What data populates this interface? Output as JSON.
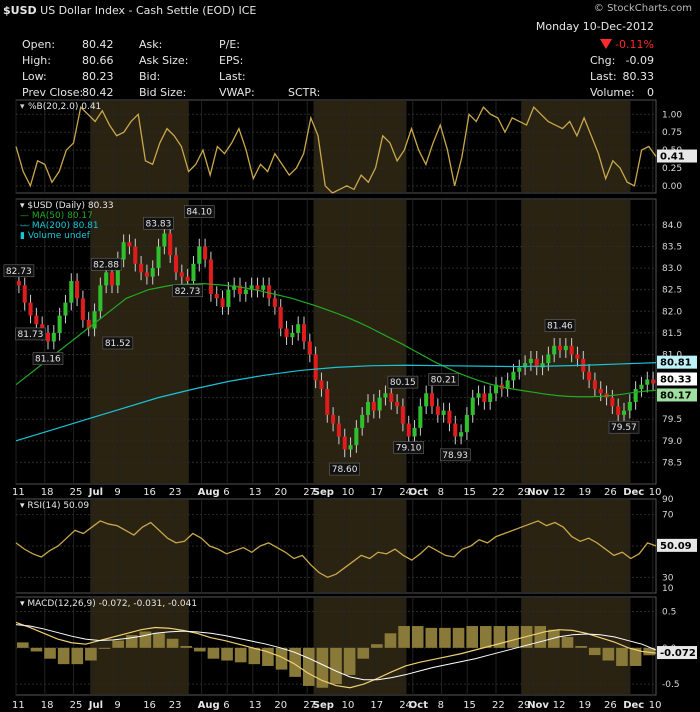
{
  "header": {
    "symbol": "$USD",
    "name": "US Dollar Index - Cash Settle (EOD)",
    "exchange": "ICE",
    "brand": "© StockCharts.com",
    "date": "Monday 10-Dec-2012",
    "change_pct": "-0.11%",
    "quote": [
      {
        "label": "Open:",
        "value": "80.42"
      },
      {
        "label": "High:",
        "value": "80.66"
      },
      {
        "label": "Low:",
        "value": "80.23"
      },
      {
        "label": "Prev Close:",
        "value": "80.42"
      }
    ],
    "col2": [
      "Ask:",
      "Ask Size:",
      "Bid:",
      "Bid Size:"
    ],
    "col3": [
      "P/E:",
      "EPS:",
      "Last:",
      "VWAP:"
    ],
    "sctr": "SCTR:",
    "right": [
      {
        "label": "Chg:",
        "value": "-0.09"
      },
      {
        "label": "Last:",
        "value": "80.33"
      },
      {
        "label": "Volume:",
        "value": "0"
      }
    ]
  },
  "colors": {
    "up": "#2fbf2f",
    "down": "#e01c1c",
    "ma50": "#22aa22",
    "ma200": "#19c4d6",
    "indicator": "#c9a84a",
    "shade": "#2a2312"
  },
  "chart_data": [
    {
      "type": "line",
      "title": "%B(20,2.0) 0.41",
      "series": [
        {
          "name": "%B(20,2.0)",
          "values": [
            0.55,
            0.2,
            0.0,
            0.35,
            0.3,
            0.05,
            0.2,
            0.5,
            0.6,
            1.1,
            1.0,
            0.9,
            1.05,
            0.85,
            0.7,
            0.75,
            0.9,
            1.0,
            0.35,
            0.3,
            0.6,
            0.8,
            0.7,
            0.55,
            0.2,
            0.3,
            0.5,
            0.15,
            0.55,
            0.45,
            0.6,
            0.8,
            0.5,
            0.1,
            0.3,
            0.2,
            0.45,
            0.3,
            0.15,
            0.25,
            0.45,
            0.95,
            0.7,
            0.0,
            -0.1,
            -0.05,
            0.0,
            -0.05,
            0.15,
            0.05,
            0.25,
            0.7,
            0.6,
            0.35,
            0.5,
            0.8,
            0.5,
            0.3,
            0.6,
            0.85,
            0.5,
            0.0,
            0.4,
            1.0,
            0.9,
            1.1,
            1.0,
            0.95,
            0.75,
            0.95,
            0.9,
            0.85,
            1.1,
            1.0,
            0.9,
            0.85,
            0.8,
            0.9,
            0.7,
            0.95,
            0.7,
            0.45,
            0.1,
            0.35,
            0.25,
            0.05,
            0.0,
            0.5,
            0.55,
            0.41
          ]
        }
      ],
      "ylim": [
        -0.1,
        1.2
      ],
      "yticks": [
        0.0,
        0.25,
        0.5,
        0.75,
        1.0
      ],
      "ytick_labels": [
        "0.00",
        "0.25",
        "0.50",
        "0.75",
        "1.00"
      ],
      "last_label": "0.41"
    },
    {
      "type": "candlestick",
      "title": "$USD (Daily) 80.33",
      "legend": [
        "MA(50) 80.17",
        "MA(200) 80.81",
        "Volume undef"
      ],
      "ylim": [
        78.0,
        84.6
      ],
      "yticks": [
        78.5,
        79.0,
        79.5,
        80.0,
        80.5,
        81.0,
        81.5,
        82.0,
        82.5,
        83.0,
        83.5,
        84.0
      ],
      "ytick_labels": [
        "78.5",
        "79.0",
        "79.5",
        "80.0",
        "80.5",
        "81.0",
        "81.5",
        "82.0",
        "82.5",
        "83.0",
        "83.5",
        "84.0"
      ],
      "closes": [
        82.6,
        82.2,
        81.9,
        81.7,
        81.5,
        81.3,
        81.5,
        81.9,
        82.2,
        82.7,
        82.3,
        81.8,
        81.6,
        82.0,
        82.6,
        82.9,
        82.6,
        83.2,
        83.6,
        83.5,
        83.1,
        82.9,
        82.8,
        83.0,
        83.5,
        83.8,
        83.3,
        82.9,
        82.8,
        82.7,
        83.1,
        83.5,
        83.2,
        82.4,
        82.3,
        82.1,
        82.5,
        82.6,
        82.4,
        82.5,
        82.6,
        82.5,
        82.6,
        82.3,
        82.1,
        81.6,
        81.4,
        81.5,
        81.7,
        81.3,
        81.0,
        80.4,
        80.2,
        79.6,
        79.4,
        79.1,
        78.8,
        78.9,
        79.3,
        79.6,
        79.9,
        79.7,
        80.0,
        80.1,
        79.9,
        79.8,
        79.4,
        79.1,
        79.3,
        79.8,
        80.1,
        79.8,
        79.6,
        79.7,
        79.4,
        79.1,
        79.2,
        79.6,
        80.0,
        80.1,
        79.9,
        80.1,
        80.3,
        80.2,
        80.4,
        80.6,
        80.7,
        80.8,
        80.9,
        80.7,
        80.8,
        81.0,
        81.2,
        81.1,
        81.2,
        81.0,
        80.9,
        80.6,
        80.4,
        80.2,
        80.1,
        80.0,
        79.8,
        79.6,
        79.7,
        79.9,
        80.2,
        80.3,
        80.42,
        80.33
      ],
      "ma50": [
        80.3,
        80.5,
        80.7,
        80.9,
        81.1,
        81.3,
        81.5,
        81.7,
        81.9,
        82.1,
        82.3,
        82.4,
        82.5,
        82.55,
        82.6,
        82.62,
        82.63,
        82.64,
        82.62,
        82.6,
        82.57,
        82.53,
        82.48,
        82.42,
        82.36,
        82.3,
        82.22,
        82.14,
        82.05,
        81.96,
        81.86,
        81.75,
        81.63,
        81.5,
        81.37,
        81.24,
        81.1,
        80.96,
        80.82,
        80.7,
        80.58,
        80.48,
        80.39,
        80.31,
        80.25,
        80.2,
        80.16,
        80.12,
        80.08,
        80.05,
        80.03,
        80.02,
        80.02,
        80.03,
        80.05,
        80.08,
        80.12,
        80.15,
        80.17
      ],
      "ma200": [
        79.0,
        79.25,
        79.5,
        79.75,
        80.0,
        80.2,
        80.38,
        80.52,
        80.63,
        80.7,
        80.74,
        80.75,
        80.74,
        80.73,
        80.72,
        80.73,
        80.75,
        80.78,
        80.81
      ],
      "annotations": [
        {
          "label": "82.73",
          "x": 0,
          "y": 82.73
        },
        {
          "label": "81.73",
          "x": 2,
          "y": 81.73
        },
        {
          "label": "81.16",
          "x": 5,
          "y": 81.16
        },
        {
          "label": "82.88",
          "x": 15,
          "y": 82.88
        },
        {
          "label": "81.52",
          "x": 17,
          "y": 81.52
        },
        {
          "label": "83.83",
          "x": 24,
          "y": 83.83
        },
        {
          "label": "84.10",
          "x": 31,
          "y": 84.1
        },
        {
          "label": "82.73",
          "x": 29,
          "y": 82.73
        },
        {
          "label": "78.60",
          "x": 56,
          "y": 78.6
        },
        {
          "label": "80.15",
          "x": 66,
          "y": 80.15
        },
        {
          "label": "79.10",
          "x": 67,
          "y": 79.1
        },
        {
          "label": "80.21",
          "x": 73,
          "y": 80.21
        },
        {
          "label": "78.93",
          "x": 75,
          "y": 78.93
        },
        {
          "label": "81.46",
          "x": 93,
          "y": 81.46
        },
        {
          "label": "79.57",
          "x": 104,
          "y": 79.57
        }
      ],
      "price_badges": [
        "80.81",
        "80.33",
        "80.17"
      ]
    },
    {
      "type": "line",
      "title": "RSI(14) 50.09",
      "series": [
        {
          "name": "RSI(14)",
          "values": [
            52,
            48,
            45,
            43,
            47,
            50,
            55,
            60,
            58,
            62,
            66,
            64,
            63,
            60,
            57,
            62,
            65,
            60,
            55,
            52,
            53,
            58,
            55,
            50,
            48,
            45,
            47,
            49,
            46,
            50,
            52,
            49,
            46,
            42,
            44,
            38,
            33,
            30,
            32,
            36,
            40,
            44,
            42,
            46,
            45,
            48,
            44,
            41,
            45,
            50,
            47,
            44,
            43,
            48,
            50,
            54,
            52,
            56,
            58,
            60,
            62,
            64,
            66,
            63,
            65,
            62,
            56,
            53,
            55,
            52,
            48,
            44,
            46,
            42,
            45,
            52,
            50.09
          ]
        }
      ],
      "ylim": [
        20,
        80
      ],
      "yticks": [
        30,
        50,
        70
      ],
      "ytick_labels": [
        "30",
        "50",
        "70"
      ],
      "extra_tick_labels": [
        "10",
        "90"
      ],
      "last_label": "50.09"
    },
    {
      "type": "line",
      "title": "MACD(12,26,9) -0.072, -0.031, -0.041",
      "series": [
        {
          "name": "MACD",
          "values": [
            0.35,
            0.28,
            0.2,
            0.12,
            0.07,
            0.05,
            0.1,
            0.15,
            0.2,
            0.25,
            0.28,
            0.27,
            0.24,
            0.2,
            0.14,
            0.1,
            0.05,
            0.0,
            -0.05,
            -0.12,
            -0.22,
            -0.35,
            -0.45,
            -0.52,
            -0.55,
            -0.5,
            -0.42,
            -0.33,
            -0.25,
            -0.2,
            -0.16,
            -0.12,
            -0.08,
            -0.03,
            0.02,
            0.07,
            0.12,
            0.17,
            0.22,
            0.25,
            0.24,
            0.2,
            0.14,
            0.08,
            0.0,
            -0.05,
            -0.072
          ]
        },
        {
          "name": "Signal",
          "values": [
            0.32,
            0.3,
            0.26,
            0.21,
            0.16,
            0.12,
            0.1,
            0.11,
            0.13,
            0.16,
            0.2,
            0.22,
            0.23,
            0.22,
            0.2,
            0.17,
            0.13,
            0.09,
            0.05,
            0.0,
            -0.06,
            -0.14,
            -0.23,
            -0.32,
            -0.4,
            -0.44,
            -0.44,
            -0.41,
            -0.37,
            -0.32,
            -0.27,
            -0.23,
            -0.19,
            -0.15,
            -0.1,
            -0.05,
            0.0,
            0.05,
            0.1,
            0.15,
            0.18,
            0.19,
            0.18,
            0.15,
            0.1,
            0.05,
            -0.031
          ]
        }
      ],
      "ylim": [
        -0.65,
        0.7
      ],
      "yticks": [
        -0.5,
        0.0,
        0.5
      ],
      "ytick_labels": [
        "-0.5",
        "0.0",
        "0.5"
      ],
      "last_label": "-0.072"
    }
  ],
  "x_axis": {
    "labels": [
      "11",
      "18",
      "25",
      "Jul",
      "9",
      "16",
      "23",
      "Aug",
      "6",
      "13",
      "20",
      "27",
      "Sep",
      "10",
      "17",
      "24",
      "Oct",
      "8",
      "15",
      "22",
      "29",
      "Nov",
      "12",
      "19",
      "26",
      "Dec",
      "10"
    ]
  }
}
